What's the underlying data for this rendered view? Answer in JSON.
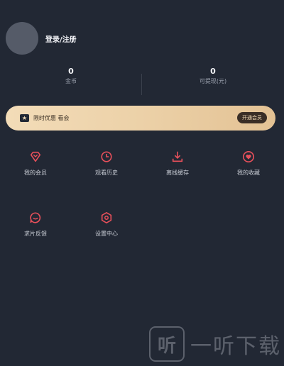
{
  "profile": {
    "login_label": "登录/注册"
  },
  "stats": [
    {
      "value": "0",
      "label": "金币"
    },
    {
      "value": "0",
      "label": "可提现(元)"
    }
  ],
  "vip": {
    "text": "限时优惠 看会",
    "button_label": "开通会员"
  },
  "menu": {
    "row1": [
      {
        "label": "我的会员",
        "icon": "diamond-icon"
      },
      {
        "label": "观看历史",
        "icon": "clock-icon"
      },
      {
        "label": "离线缓存",
        "icon": "download-icon"
      },
      {
        "label": "我的收藏",
        "icon": "heart-icon"
      }
    ],
    "row2": [
      {
        "label": "求片反馈",
        "icon": "smile-chat-icon"
      },
      {
        "label": "设置中心",
        "icon": "settings-hexagon-icon"
      }
    ]
  },
  "watermark": {
    "logo_text": "听",
    "text": "一听下载"
  },
  "colors": {
    "background": "#222834",
    "accent": "#e8505b",
    "vip_gold": "#ecd1a8"
  }
}
